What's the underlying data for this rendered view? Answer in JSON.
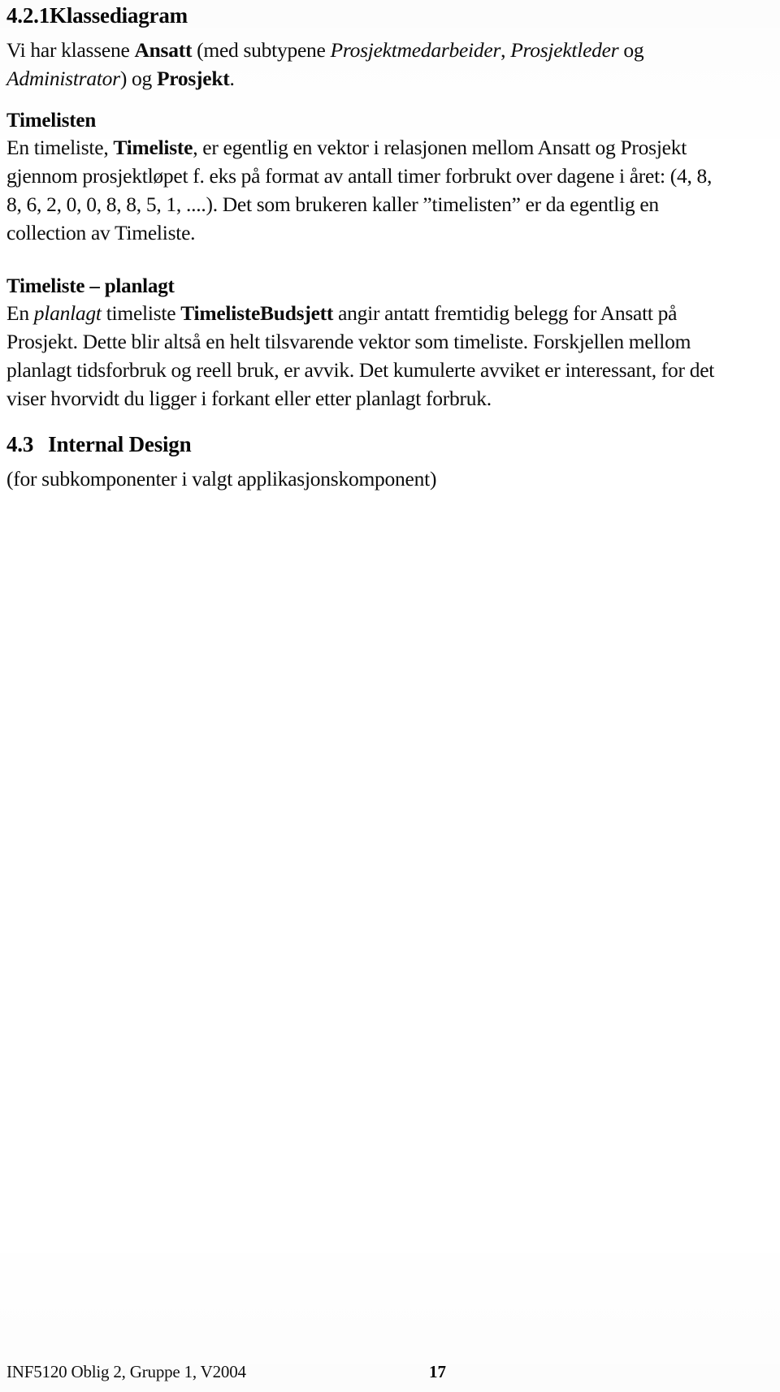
{
  "document": {
    "heading1": {
      "number": "4.2.1",
      "title": "Klassediagram"
    },
    "intro_paragraph": {
      "seg1": "Vi har klassene ",
      "bold1": "Ansatt",
      "seg2": " (med subtypene ",
      "ital1": "Prosjektmedarbeider",
      "seg3": ", ",
      "ital2": "Prosjektleder",
      "seg4": " og ",
      "ital3": "Administrator",
      "seg5": ") og ",
      "bold2": "Prosjekt",
      "seg6": "."
    },
    "timelisten": {
      "heading": "Timelisten",
      "seg1": "En timeliste, ",
      "bold1": "Timeliste",
      "seg2": ", er egentlig en vektor i relasjonen mellom Ansatt og Prosjekt gjennom prosjektløpet f. eks på format av antall timer forbrukt over dagene i året: (4, 8, 8, 6, 2, 0, 0, 8, 8, 5, 1, ....). Det som brukeren kaller ”timelisten” er da egentlig en collection av Timeliste."
    },
    "timeliste_planlagt": {
      "heading": "Timeliste – planlagt",
      "seg1": "En ",
      "ital1": "planlagt",
      "seg2": " timeliste ",
      "bold1": "TimelisteBudsjett",
      "seg3": " angir antatt fremtidig belegg for Ansatt på Prosjekt. Dette blir altså en helt tilsvarende vektor som timeliste. Forskjellen mellom planlagt tidsforbruk og reell bruk, er avvik. Det kumulerte avviket er interessant, for det viser hvorvidt du ligger i forkant eller etter planlagt forbruk."
    },
    "heading2": {
      "number": "4.3",
      "title": "Internal Design"
    },
    "subnote": "(for subkomponenter i valgt applikasjonskomponent)"
  },
  "footer": {
    "left_text": "INF5120 Oblig 2, Gruppe 1, V2004",
    "page_number": "17"
  }
}
